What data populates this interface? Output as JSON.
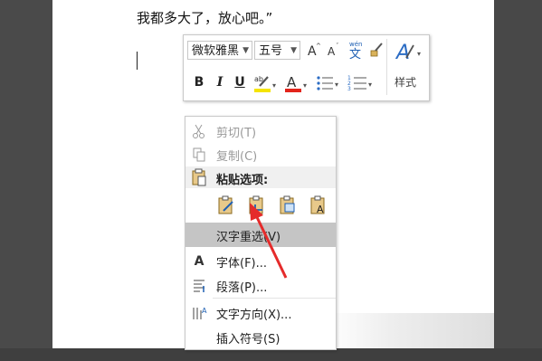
{
  "document": {
    "text_line": "我都多大了，放心吧。”"
  },
  "mini_toolbar": {
    "font_name": "微软雅黑",
    "font_size": "五号",
    "bold": "B",
    "italic": "I",
    "underline": "U",
    "styles_label": "样式",
    "highlight_color": "#f5e400",
    "font_color": "#e3241b",
    "accent": "#2b6cc4"
  },
  "context_menu": {
    "cut": "剪切(T)",
    "copy": "复制(C)",
    "paste_options": "粘贴选项:",
    "hanzi_reconvert": "汉字重选(V)",
    "font": "字体(F)...",
    "paragraph": "段落(P)...",
    "text_direction": "文字方向(X)...",
    "insert_symbol": "插入符号(S)"
  },
  "annotation": {
    "arrow_color": "#e52b2b"
  }
}
